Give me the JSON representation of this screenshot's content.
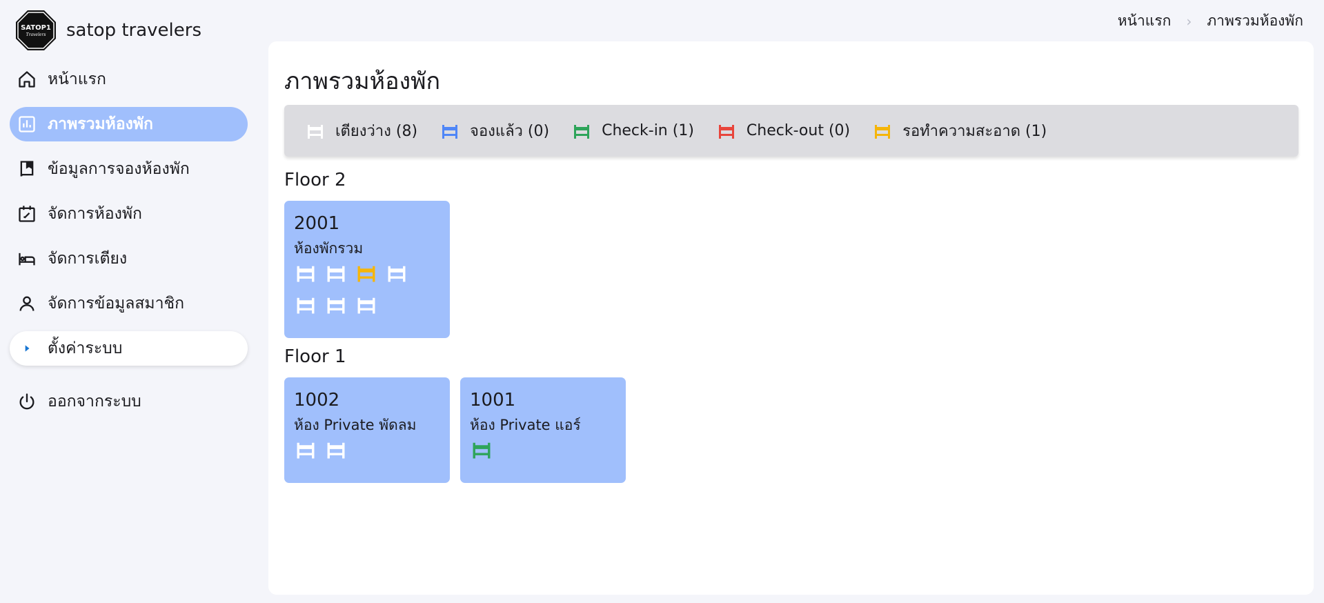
{
  "brand": {
    "name": "satop travelers",
    "logo_text": "SATOP1",
    "logo_sub": "Travelers"
  },
  "breadcrumb": {
    "home": "หน้าแรก",
    "separator": "›",
    "current": "ภาพรวมห้องพัก"
  },
  "sidebar": {
    "items": [
      {
        "label": "หน้าแรก",
        "icon": "home-icon"
      },
      {
        "label": "ภาพรวมห้องพัก",
        "icon": "chart-icon",
        "active": true
      },
      {
        "label": "ข้อมูลการจองห้องพัก",
        "icon": "book-icon"
      },
      {
        "label": "จัดการห้องพัก",
        "icon": "calendar-edit-icon"
      },
      {
        "label": "จัดการเตียง",
        "icon": "bed-icon"
      },
      {
        "label": "จัดการข้อมูลสมาชิก",
        "icon": "user-icon"
      },
      {
        "label": "ตั้งค่าระบบ",
        "icon": "caret-right-icon"
      },
      {
        "label": "ออกจากระบบ",
        "icon": "power-icon"
      }
    ]
  },
  "main": {
    "title": "ภาพรวมห้องพัก",
    "legend": [
      {
        "label": "เตียงว่าง (8)",
        "color": "#ffffff"
      },
      {
        "label": "จองแล้ว (0)",
        "color": "#4f86f7"
      },
      {
        "label": "Check-in (1)",
        "color": "#2ea45a"
      },
      {
        "label": "Check-out (0)",
        "color": "#e8453c"
      },
      {
        "label": "รอทำความสะอาด (1)",
        "color": "#f5b50a"
      }
    ],
    "floors": [
      {
        "name": "Floor 2",
        "rooms": [
          {
            "number": "2001",
            "type": "ห้องพักรวม",
            "beds": [
              "free",
              "free",
              "cleaning",
              "free",
              "free",
              "free",
              "free"
            ]
          }
        ]
      },
      {
        "name": "Floor 1",
        "rooms": [
          {
            "number": "1002",
            "type": "ห้อง Private พัดลม",
            "beds": [
              "free",
              "free"
            ]
          },
          {
            "number": "1001",
            "type": "ห้อง Private แอร์",
            "beds": [
              "checkin"
            ]
          }
        ]
      }
    ]
  },
  "colors": {
    "accent": "#a0bffc",
    "free": "#ffffff",
    "booked": "#4f86f7",
    "checkin": "#2ea45a",
    "checkout": "#e8453c",
    "cleaning": "#f5b50a"
  }
}
